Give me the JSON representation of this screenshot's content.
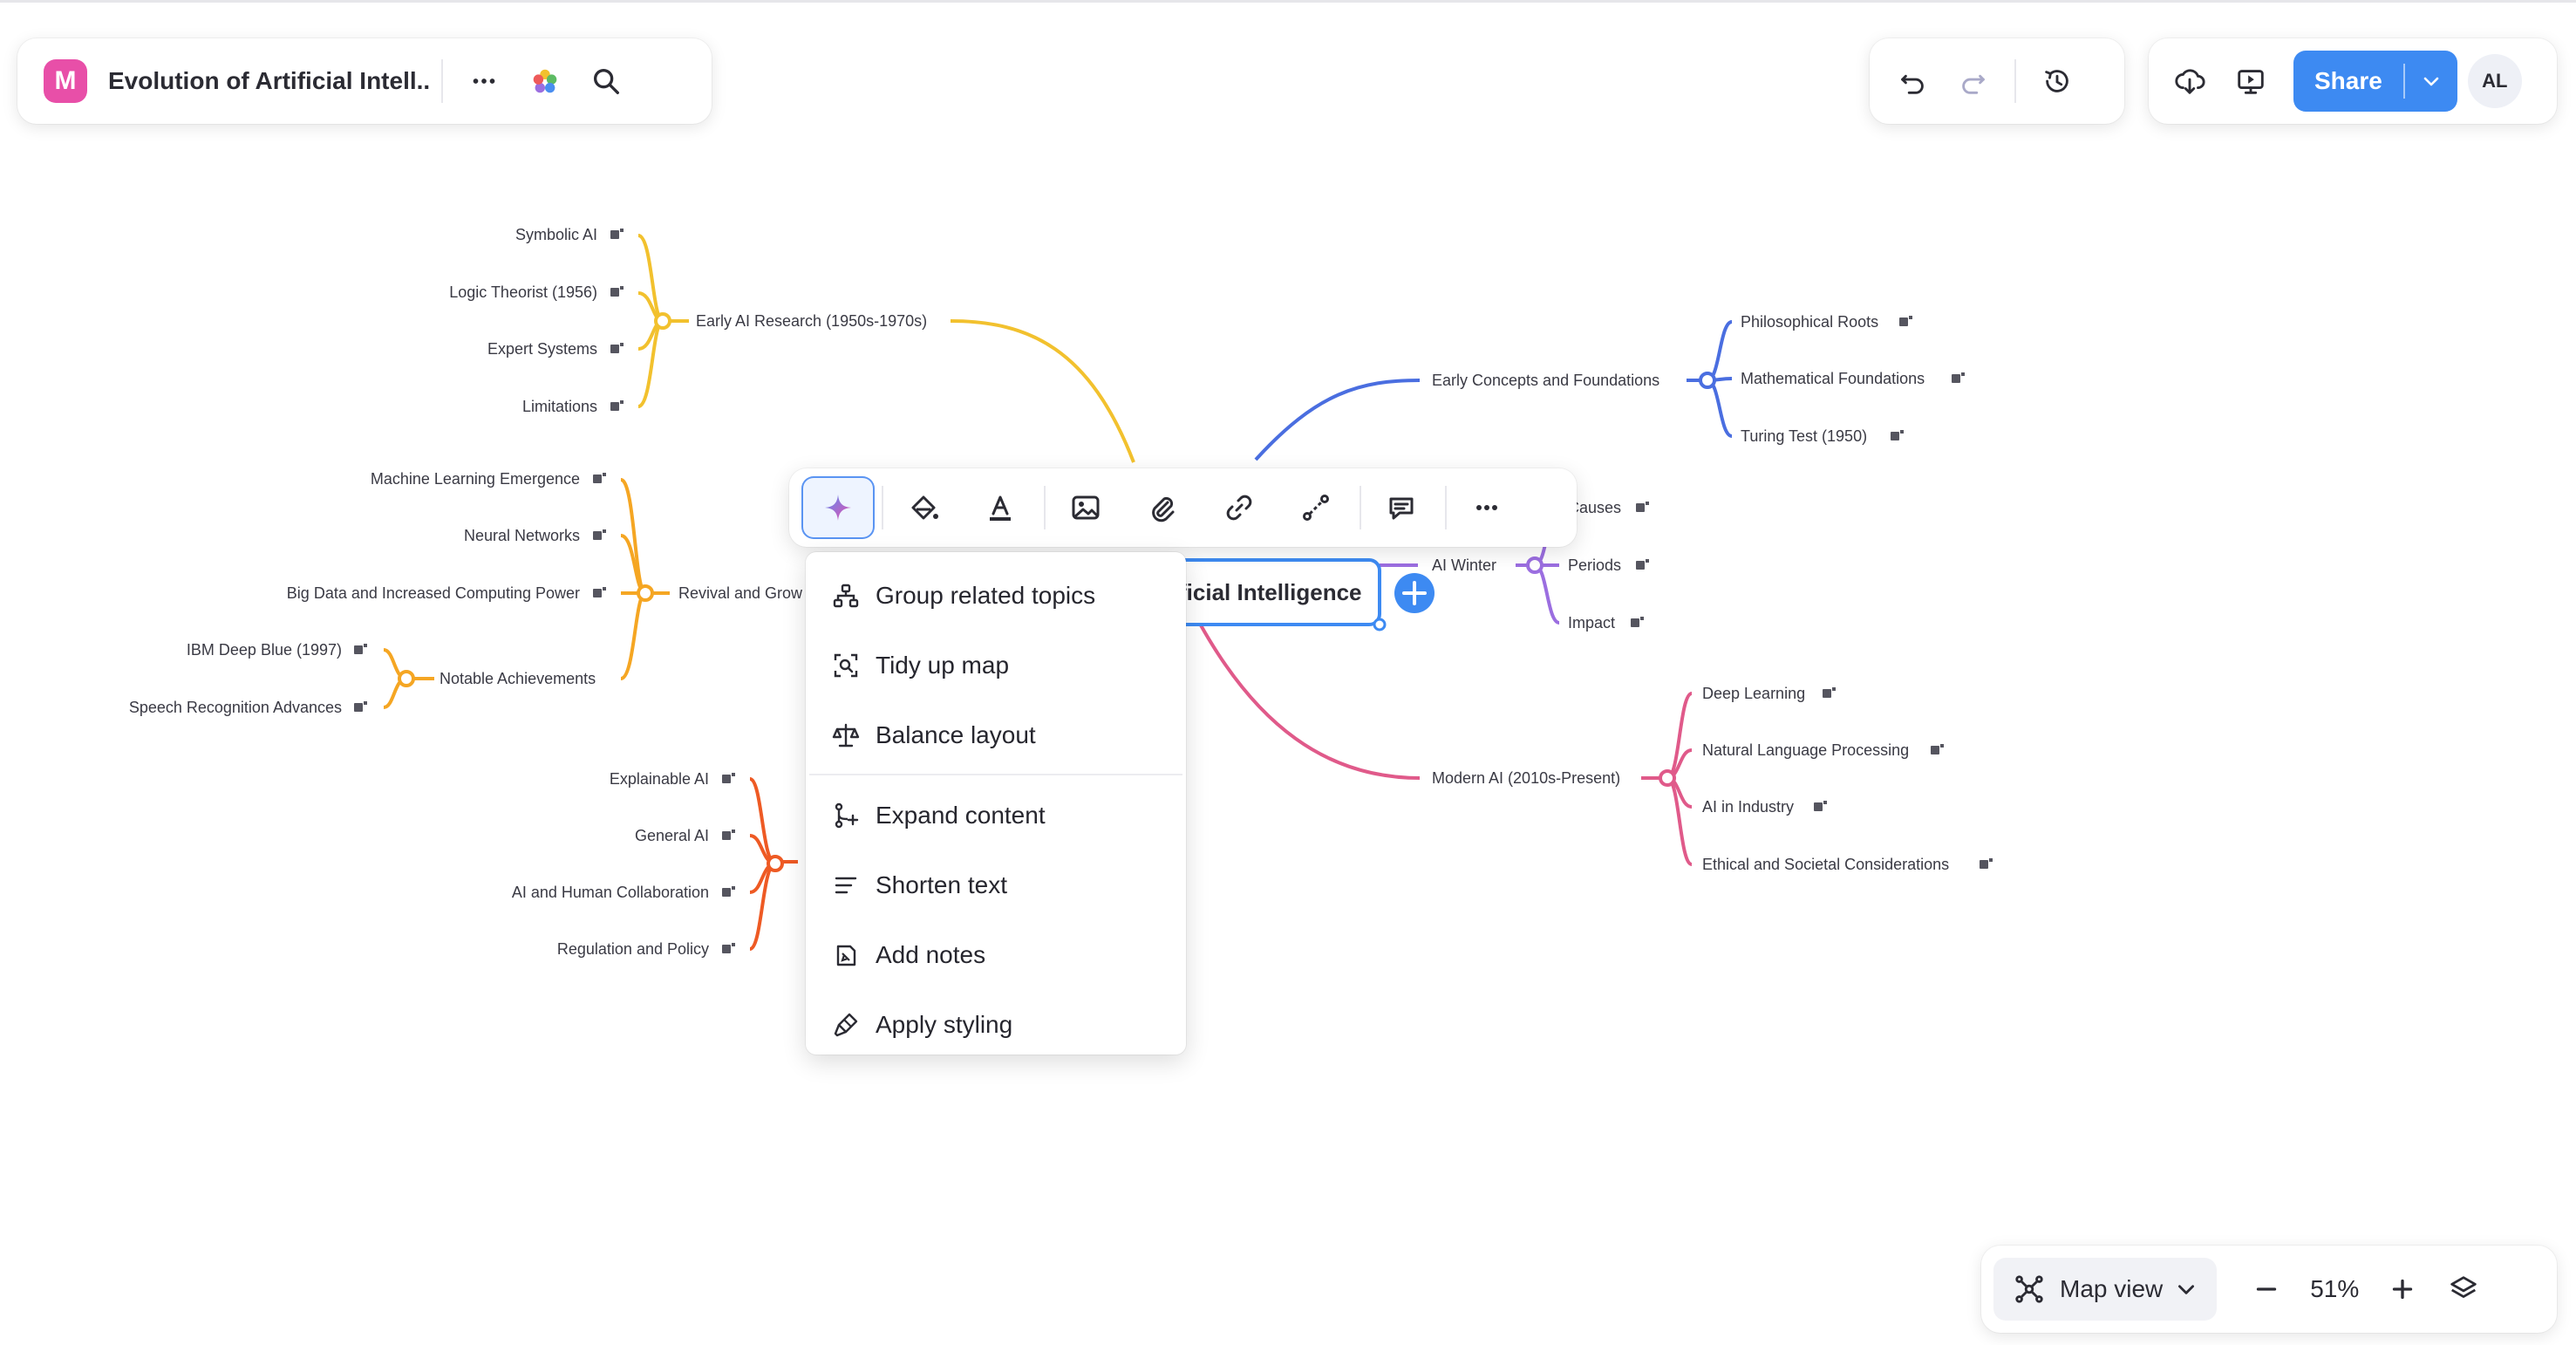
{
  "header": {
    "doc_title": "Evolution of Artificial Intell...",
    "logo_letter": "M"
  },
  "topbar": {
    "share_label": "Share",
    "avatar_initials": "AL"
  },
  "map": {
    "root_label": "ficial Intelligence",
    "branches": {
      "early_research": {
        "label": "Early AI Research (1950s-1970s)",
        "color": "#f2c12e",
        "children": [
          "Symbolic AI",
          "Logic Theorist (1956)",
          "Expert Systems",
          "Limitations"
        ]
      },
      "revival": {
        "label": "Revival and Grow",
        "color": "#f5a623",
        "children": [
          "Machine Learning Emergence",
          "Neural Networks",
          "Big Data and Increased Computing Power",
          "Notable Achievements"
        ],
        "achievements": [
          "IBM Deep Blue (1997)",
          "Speech Recognition Advances"
        ]
      },
      "future": {
        "color": "#ee5a24",
        "children": [
          "Explainable AI",
          "General AI",
          "AI and Human Collaboration",
          "Regulation and Policy"
        ]
      },
      "foundations": {
        "label": "Early Concepts and Foundations",
        "color": "#4a6ee0",
        "children": [
          "Philosophical Roots",
          "Mathematical Foundations",
          "Turing Test (1950)"
        ]
      },
      "winter": {
        "label": "AI Winter",
        "color": "#9b6ee0",
        "children": [
          "Causes",
          "Periods",
          "Impact"
        ]
      },
      "modern": {
        "label": "Modern AI (2010s-Present)",
        "color": "#e05a8a",
        "children": [
          "Deep Learning",
          "Natural Language Processing",
          "AI in Industry",
          "Ethical and Societal Considerations"
        ]
      }
    }
  },
  "ai_menu": {
    "items": [
      {
        "label": "Group related topics",
        "icon": "hierarchy-icon"
      },
      {
        "label": "Tidy up map",
        "icon": "tidy-icon"
      },
      {
        "label": "Balance layout",
        "icon": "scale-icon"
      },
      {
        "label": "Expand content",
        "icon": "branch-icon"
      },
      {
        "label": "Shorten text",
        "icon": "shorten-icon"
      },
      {
        "label": "Add notes",
        "icon": "note-icon"
      },
      {
        "label": "Apply styling",
        "icon": "brush-icon"
      }
    ]
  },
  "bottom_bar": {
    "view_label": "Map view",
    "zoom": "51%"
  },
  "colors": {
    "accent": "#3d8af2",
    "selection": "#3d8af2"
  }
}
